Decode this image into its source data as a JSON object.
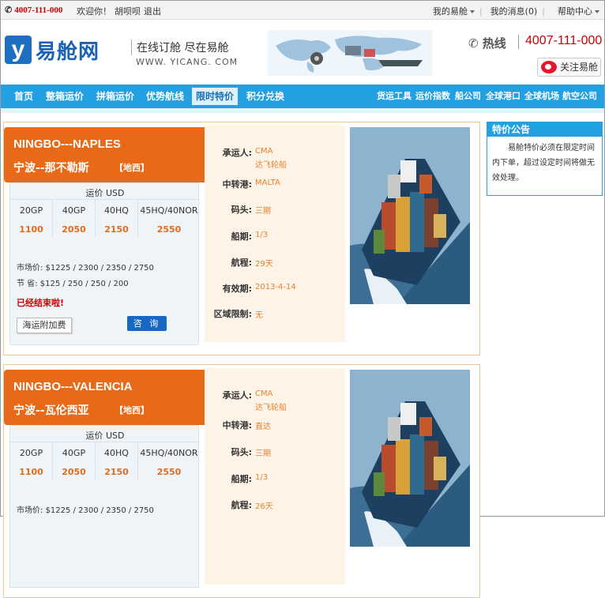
{
  "topbar": {
    "phone": "4007-111-000",
    "welcome": "欢迎你！",
    "user": "胡呗呗",
    "logout": "退出",
    "my_yicang": "我的易舱",
    "my_messages": "我的消息(0)",
    "help": "帮助中心"
  },
  "header": {
    "logo_letter": "y",
    "logo_text": "易舱网",
    "slogan": "在线订舱  尽在易舱",
    "slogan_en": "WWW. YICANG. COM",
    "hotline_label": "热线",
    "hotline_number": "4007-111-000",
    "follow": "关注易舱"
  },
  "nav": {
    "left": [
      "首页",
      "整箱运价",
      "拼箱运价",
      "优势航线",
      "限时特价",
      "积分兑换"
    ],
    "active_index": 4,
    "right": [
      "货运工具",
      "运价指数",
      "船公司",
      "全球港口",
      "全球机场",
      "航空公司"
    ]
  },
  "cards": [
    {
      "route": "NINGBO---NAPLES",
      "route_cn": "宁波--那不勒斯",
      "region": "【地西】",
      "price_unit": "运价 USD",
      "containers": [
        "20GP",
        "40GP",
        "40HQ",
        "45HQ/40NOR"
      ],
      "prices": [
        "1100",
        "2050",
        "2150",
        "2550"
      ],
      "market_label": "市场价:",
      "market": "$1225 / 2300 / 2350 / 2750",
      "save_label": "节    省:",
      "save": "$125 / 250 / 250 / 200",
      "status": "已经结束啦!",
      "surcharge_btn": "海运附加费",
      "inquiry_btn": "咨 询",
      "info": {
        "carrier_label": "承运人:",
        "carrier": "CMA",
        "carrier_cn": "达飞轮船",
        "transit_label": "中转港:",
        "transit": "MALTA",
        "terminal_label": "码头:",
        "terminal": "三期",
        "schedule_label": "船期:",
        "schedule": "1/3",
        "voyage_label": "航程:",
        "voyage": "29天",
        "valid_label": "有效期:",
        "valid": "2013-4-14",
        "area_label": "区域限制:",
        "area": "无"
      }
    },
    {
      "route": "NINGBO---VALENCIA",
      "route_cn": "宁波--瓦伦西亚",
      "region": "【地西】",
      "price_unit": "运价 USD",
      "containers": [
        "20GP",
        "40GP",
        "40HQ",
        "45HQ/40NOR"
      ],
      "prices": [
        "1100",
        "2050",
        "2150",
        "2550"
      ],
      "market_label": "市场价:",
      "market": "$1225 / 2300 / 2350 / 2750",
      "info": {
        "carrier_label": "承运人:",
        "carrier": "CMA",
        "carrier_cn": "达飞轮船",
        "transit_label": "中转港:",
        "transit": "直达",
        "terminal_label": "码头:",
        "terminal": "三期",
        "schedule_label": "船期:",
        "schedule": "1/3",
        "voyage_label": "航程:",
        "voyage": "26天"
      }
    }
  ],
  "notice": {
    "title": "特价公告",
    "body": "易舱特价必须在限定时间内下单，超过设定时间将做无效处理。"
  },
  "colors": {
    "nav_blue": "#23a0e2",
    "banner_orange": "#e86a18",
    "price_orange": "#e86a18",
    "hotline_red": "#cc0000"
  }
}
